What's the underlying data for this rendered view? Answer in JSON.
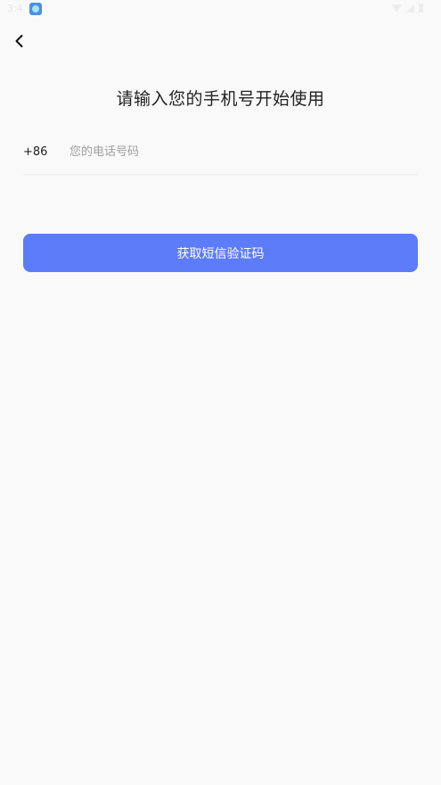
{
  "status_bar": {
    "time": "3:4",
    "app_icon": "app-notification-icon",
    "icons": [
      "wifi-icon",
      "signal-icon",
      "battery-icon"
    ]
  },
  "nav": {
    "back_icon": "chevron-left-icon"
  },
  "page": {
    "title": "请输入您的手机号开始使用"
  },
  "phone": {
    "country_code": "+86",
    "placeholder": "您的电话号码",
    "value": ""
  },
  "actions": {
    "get_code_label": "获取短信验证码"
  },
  "colors": {
    "background": "#F9F9F9",
    "primary": "#5C7CFA",
    "text": "#222222",
    "placeholder": "#9E9E9E",
    "divider": "#EEEEEE"
  }
}
